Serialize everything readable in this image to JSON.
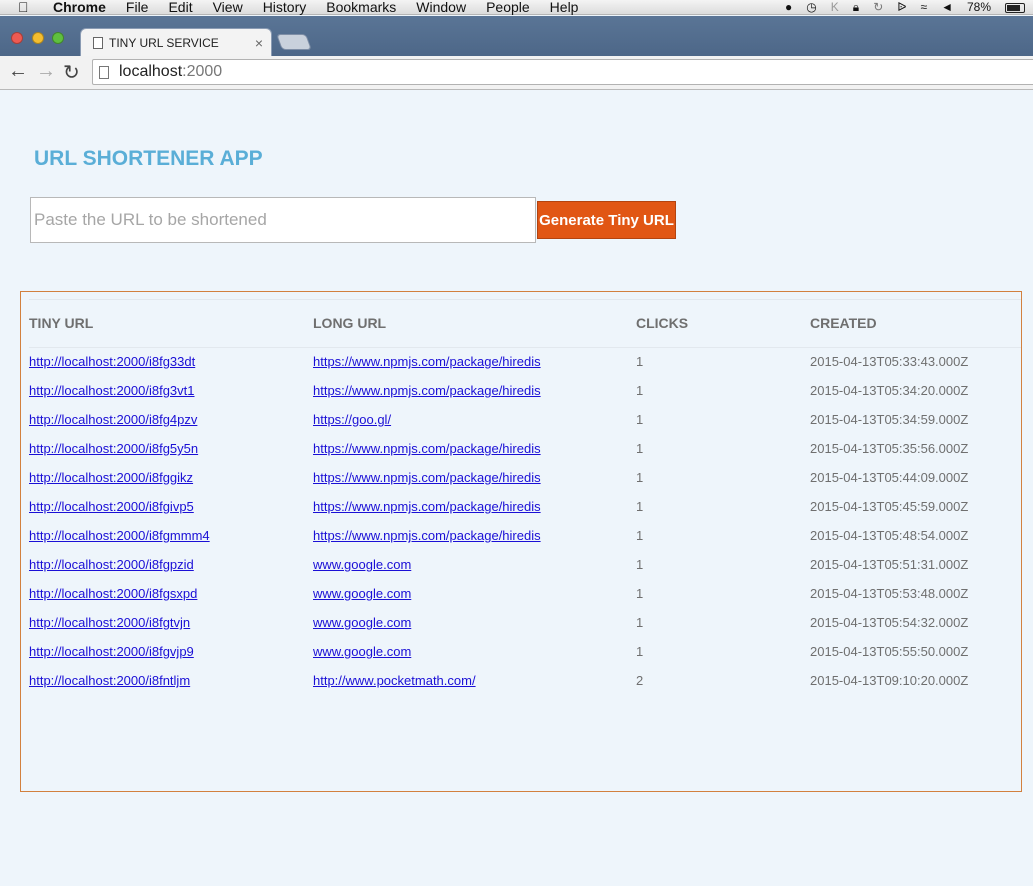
{
  "menubar": {
    "app": "Chrome",
    "items": [
      "File",
      "Edit",
      "View",
      "History",
      "Bookmarks",
      "Window",
      "People",
      "Help"
    ],
    "battery": "78%"
  },
  "browser": {
    "tab_title": "TINY URL SERVICE",
    "url_host": "localhost",
    "url_port": ":2000"
  },
  "page": {
    "title": "URL SHORTENER APP",
    "input_placeholder": "Paste the URL to be shortened",
    "button_label": "Generate Tiny URL",
    "columns": [
      "TINY URL",
      "LONG URL",
      "CLICKS",
      "CREATED"
    ],
    "rows": [
      {
        "tiny": "http://localhost:2000/i8fg33dt",
        "long": "https://www.npmjs.com/package/hiredis",
        "clicks": "1",
        "created": "2015-04-13T05:33:43.000Z"
      },
      {
        "tiny": "http://localhost:2000/i8fg3vt1",
        "long": "https://www.npmjs.com/package/hiredis",
        "clicks": "1",
        "created": "2015-04-13T05:34:20.000Z"
      },
      {
        "tiny": "http://localhost:2000/i8fg4pzv",
        "long": "https://goo.gl/",
        "clicks": "1",
        "created": "2015-04-13T05:34:59.000Z"
      },
      {
        "tiny": "http://localhost:2000/i8fg5y5n",
        "long": "https://www.npmjs.com/package/hiredis",
        "clicks": "1",
        "created": "2015-04-13T05:35:56.000Z"
      },
      {
        "tiny": "http://localhost:2000/i8fggikz",
        "long": "https://www.npmjs.com/package/hiredis",
        "clicks": "1",
        "created": "2015-04-13T05:44:09.000Z"
      },
      {
        "tiny": "http://localhost:2000/i8fgivp5",
        "long": "https://www.npmjs.com/package/hiredis",
        "clicks": "1",
        "created": "2015-04-13T05:45:59.000Z"
      },
      {
        "tiny": "http://localhost:2000/i8fgmmm4",
        "long": "https://www.npmjs.com/package/hiredis",
        "clicks": "1",
        "created": "2015-04-13T05:48:54.000Z"
      },
      {
        "tiny": "http://localhost:2000/i8fgpzid",
        "long": "www.google.com",
        "clicks": "1",
        "created": "2015-04-13T05:51:31.000Z"
      },
      {
        "tiny": "http://localhost:2000/i8fgsxpd",
        "long": "www.google.com",
        "clicks": "1",
        "created": "2015-04-13T05:53:48.000Z"
      },
      {
        "tiny": "http://localhost:2000/i8fgtvjn",
        "long": "www.google.com",
        "clicks": "1",
        "created": "2015-04-13T05:54:32.000Z"
      },
      {
        "tiny": "http://localhost:2000/i8fgvjp9",
        "long": "www.google.com",
        "clicks": "1",
        "created": "2015-04-13T05:55:50.000Z"
      },
      {
        "tiny": "http://localhost:2000/i8fntljm",
        "long": "http://www.pocketmath.com/",
        "clicks": "2",
        "created": "2015-04-13T09:10:20.000Z"
      }
    ]
  },
  "colors": {
    "accent_title": "#5aaed7",
    "button": "#e15614",
    "table_border": "#d2803e",
    "link": "#1a0fd6"
  }
}
